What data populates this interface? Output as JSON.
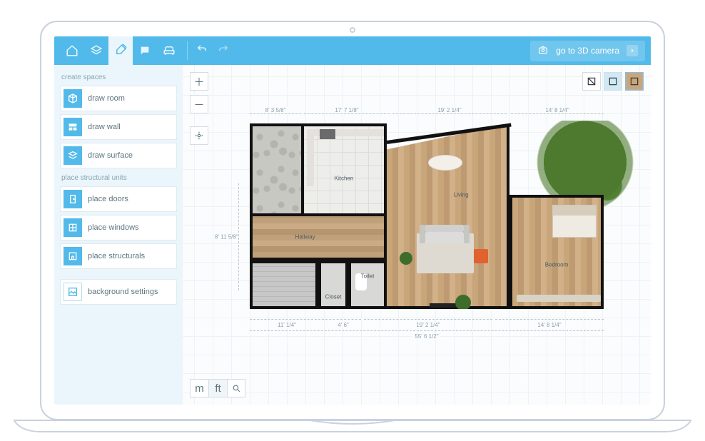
{
  "toolbar": {
    "go3d_label": "go to 3D camera"
  },
  "sidebar": {
    "sections": {
      "create_label": "create spaces",
      "structural_label": "place structural units"
    },
    "items": {
      "draw_room": "draw room",
      "draw_wall": "draw wall",
      "draw_surface": "draw surface",
      "place_doors": "place doors",
      "place_windows": "place windows",
      "place_structurals": "place structurals",
      "background_settings": "background settings"
    }
  },
  "units": {
    "m": "m",
    "ft": "ft"
  },
  "rooms": {
    "kitchen": "Kitchen",
    "living": "Living",
    "hallway": "Hallway",
    "closet": "Closet",
    "toilet": "Toilet",
    "bedroom": "Bedroom"
  },
  "dimensions": {
    "top": {
      "d1": "8' 3 5/8\"",
      "d2": "17' 7 1/8\"",
      "d3": "19' 2 1/4\"",
      "d4": "14' 8 1/4\""
    },
    "bottom": {
      "d1": "11' 1/4\"",
      "d2": "4' 6\"",
      "d3": "19' 2 1/4\"",
      "d4": "14' 8 1/4\""
    },
    "bottom_total": "55' 6 1/2\"",
    "left": {
      "d1": "8' 11 5/8\""
    }
  }
}
